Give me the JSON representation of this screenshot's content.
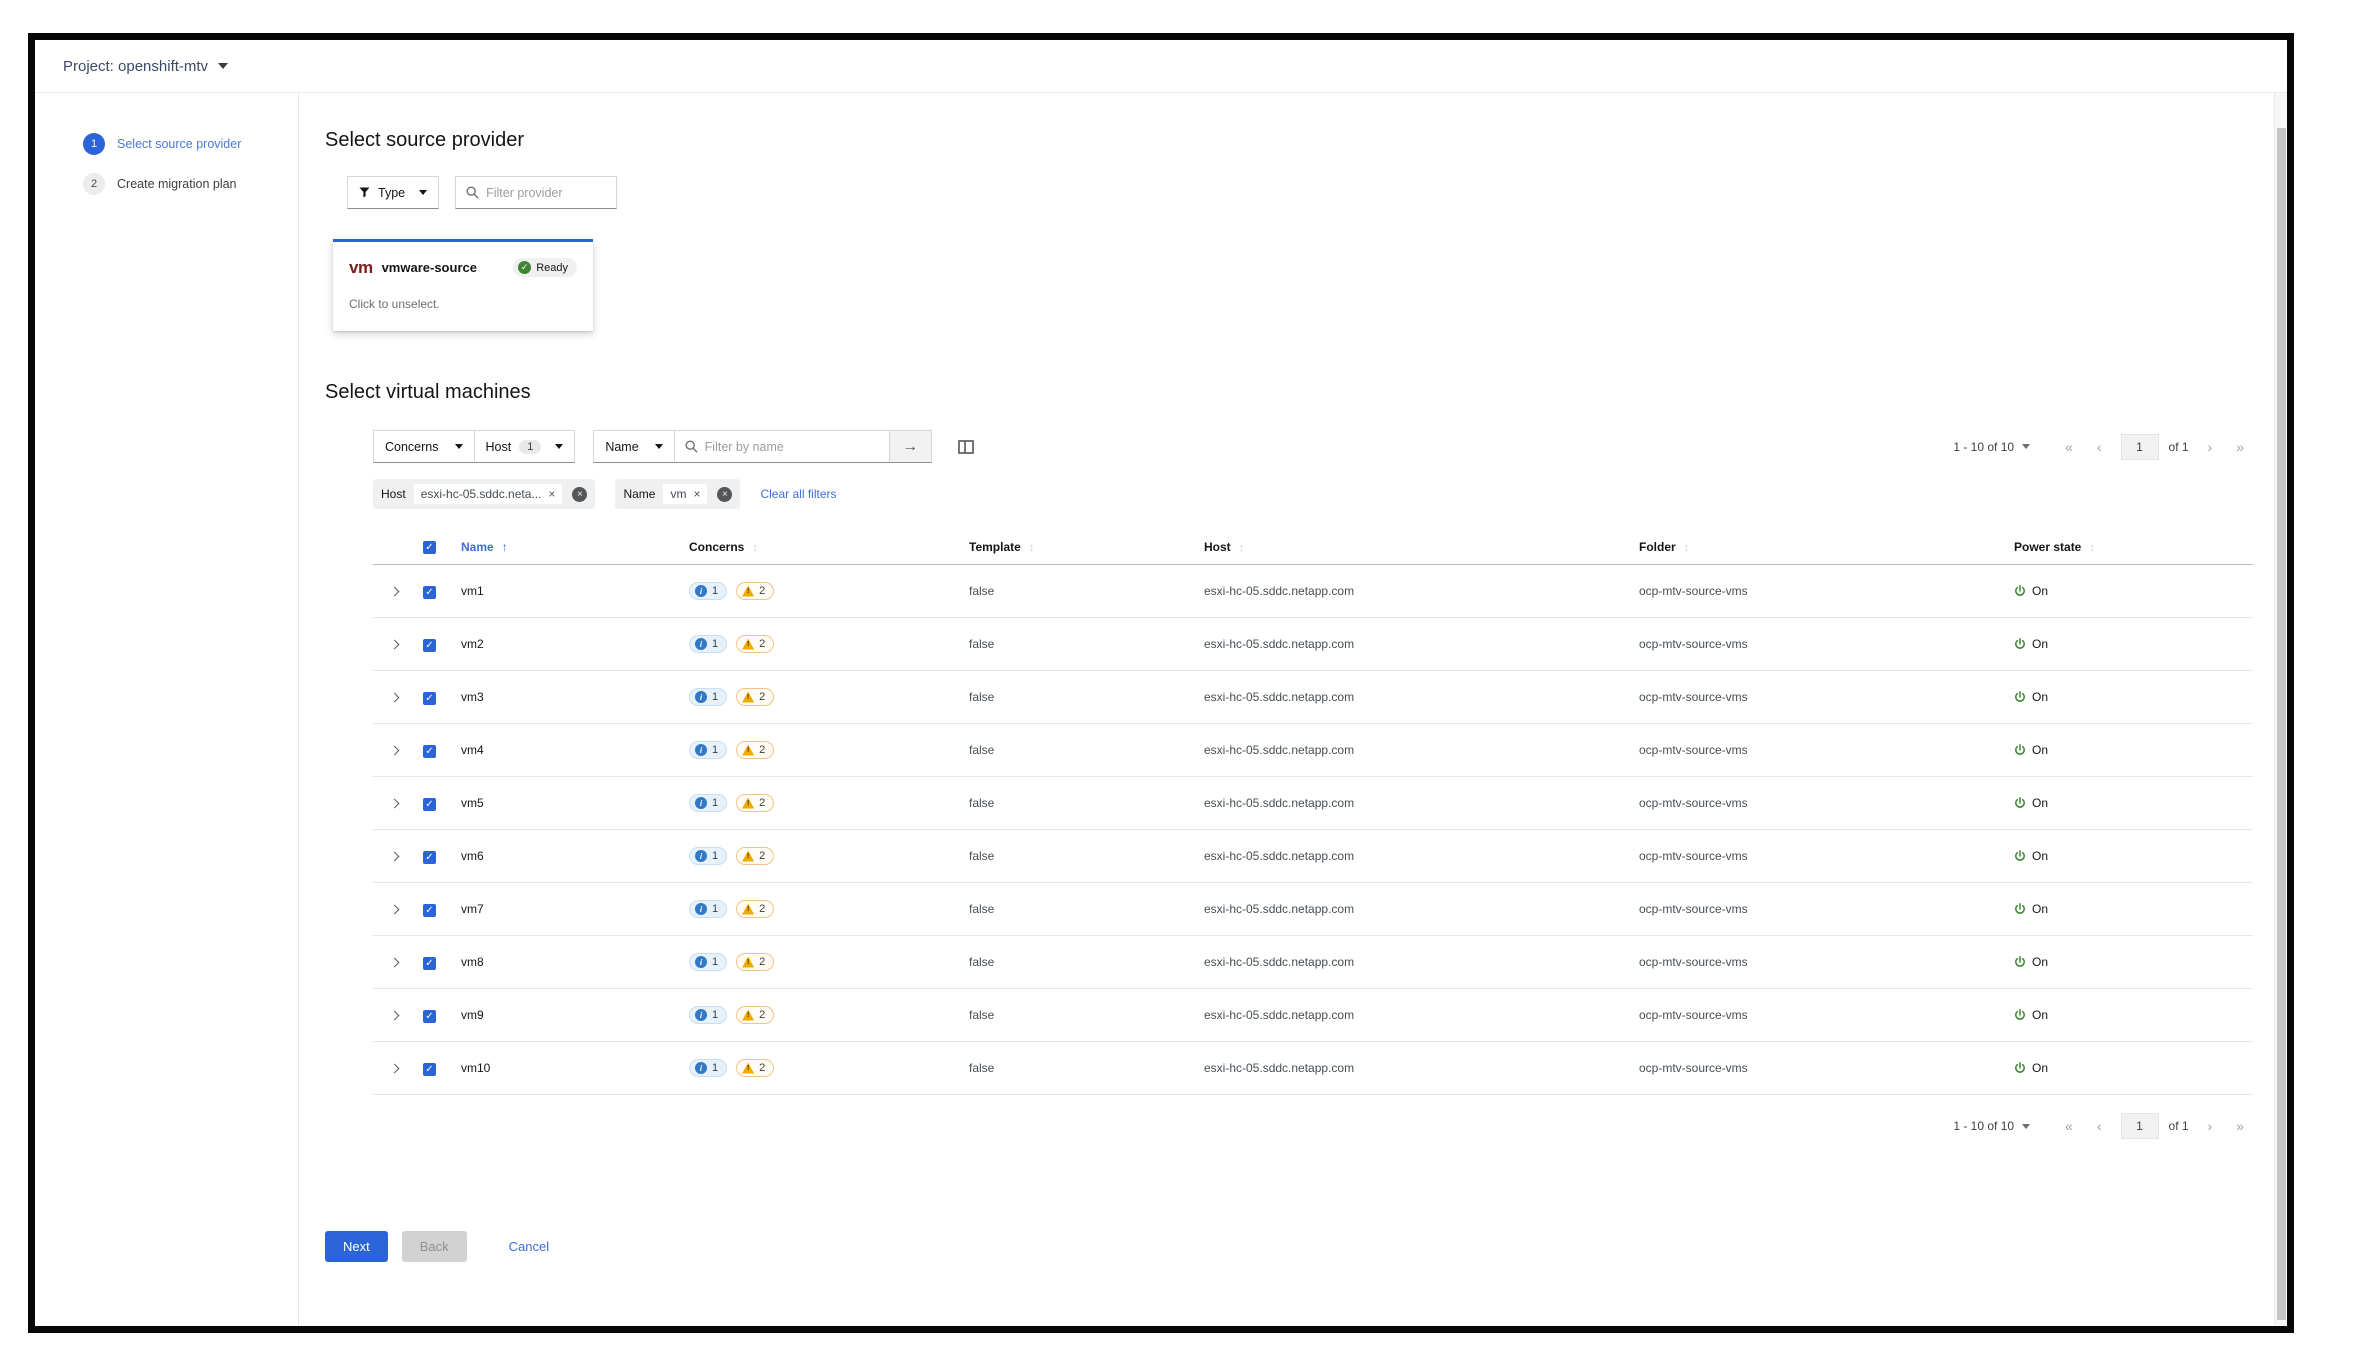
{
  "topbar": {
    "project_label": "Project: openshift-mtv"
  },
  "wizard": {
    "steps": [
      {
        "number": "1",
        "label": "Select source provider"
      },
      {
        "number": "2",
        "label": "Create migration plan"
      }
    ]
  },
  "provider_section": {
    "title": "Select source provider",
    "type_filter_label": "Type",
    "filter_placeholder": "Filter provider",
    "card": {
      "logo": "vm",
      "name": "vmware-source",
      "status": "Ready",
      "status_check": "✓",
      "hint": "Click to unselect."
    }
  },
  "vm_section": {
    "title": "Select virtual machines",
    "toolbar": {
      "concerns_label": "Concerns",
      "host_label": "Host",
      "host_badge": "1",
      "name_label": "Name",
      "search_placeholder": "Filter by name",
      "go_arrow": "→"
    },
    "chips": {
      "host_group_label": "Host",
      "host_chip": "esxi-hc-05.sddc.neta...",
      "name_group_label": "Name",
      "name_chip": "vm",
      "chip_close": "×",
      "group_close": "×",
      "clear_all_label": "Clear all filters"
    },
    "pagination": {
      "range": "1 - 10 of 10",
      "first": "«",
      "prev": "‹",
      "page": "1",
      "of_label": "of 1",
      "next": "›",
      "last": "»"
    },
    "table": {
      "columns": [
        "Name",
        "Concerns",
        "Template",
        "Host",
        "Folder",
        "Power state"
      ],
      "sort_glyph_active": "↑",
      "sort_glyph": "↕",
      "check_glyph": "✓",
      "rows": [
        {
          "name": "vm1",
          "info_count": "1",
          "warn_count": "2",
          "template": "false",
          "host": "esxi-hc-05.sddc.netapp.com",
          "folder": "ocp-mtv-source-vms",
          "power": "On"
        },
        {
          "name": "vm2",
          "info_count": "1",
          "warn_count": "2",
          "template": "false",
          "host": "esxi-hc-05.sddc.netapp.com",
          "folder": "ocp-mtv-source-vms",
          "power": "On"
        },
        {
          "name": "vm3",
          "info_count": "1",
          "warn_count": "2",
          "template": "false",
          "host": "esxi-hc-05.sddc.netapp.com",
          "folder": "ocp-mtv-source-vms",
          "power": "On"
        },
        {
          "name": "vm4",
          "info_count": "1",
          "warn_count": "2",
          "template": "false",
          "host": "esxi-hc-05.sddc.netapp.com",
          "folder": "ocp-mtv-source-vms",
          "power": "On"
        },
        {
          "name": "vm5",
          "info_count": "1",
          "warn_count": "2",
          "template": "false",
          "host": "esxi-hc-05.sddc.netapp.com",
          "folder": "ocp-mtv-source-vms",
          "power": "On"
        },
        {
          "name": "vm6",
          "info_count": "1",
          "warn_count": "2",
          "template": "false",
          "host": "esxi-hc-05.sddc.netapp.com",
          "folder": "ocp-mtv-source-vms",
          "power": "On"
        },
        {
          "name": "vm7",
          "info_count": "1",
          "warn_count": "2",
          "template": "false",
          "host": "esxi-hc-05.sddc.netapp.com",
          "folder": "ocp-mtv-source-vms",
          "power": "On"
        },
        {
          "name": "vm8",
          "info_count": "1",
          "warn_count": "2",
          "template": "false",
          "host": "esxi-hc-05.sddc.netapp.com",
          "folder": "ocp-mtv-source-vms",
          "power": "On"
        },
        {
          "name": "vm9",
          "info_count": "1",
          "warn_count": "2",
          "template": "false",
          "host": "esxi-hc-05.sddc.netapp.com",
          "folder": "ocp-mtv-source-vms",
          "power": "On"
        },
        {
          "name": "vm10",
          "info_count": "1",
          "warn_count": "2",
          "template": "false",
          "host": "esxi-hc-05.sddc.netapp.com",
          "folder": "ocp-mtv-source-vms",
          "power": "On"
        }
      ]
    }
  },
  "footer": {
    "next_label": "Next",
    "back_label": "Back",
    "cancel_label": "Cancel"
  },
  "colors": {
    "accent_blue": "#2b64d9",
    "link_blue": "#3a6fd4",
    "success_green": "#3e8635",
    "warning_gold": "#f0ab00",
    "info_blue": "#3178c6",
    "vmware_maroon": "#7a1e1e"
  }
}
